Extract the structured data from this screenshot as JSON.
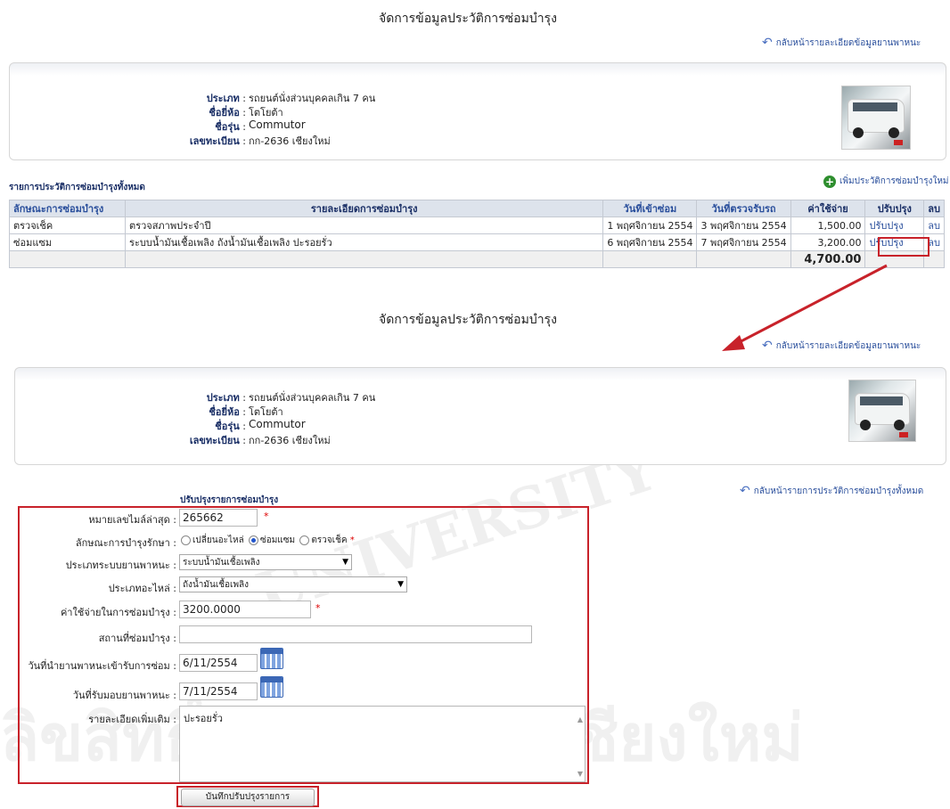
{
  "page_title": "จัดการข้อมูลประวัติการซ่อมบำรุง",
  "back_link_vehicle": "กลับหน้ารายละเอียดข้อมูลยานพาหนะ",
  "vehicle": {
    "type_label": "ประเภท",
    "type_value": "รถยนต์นั่งส่วนบุคคลเกิน 7 คน",
    "brand_label": "ชื่อยี่ห้อ",
    "brand_value": "โตโยต้า",
    "model_label": "ชื่อรุ่น",
    "model_value": "Commutor",
    "plate_label": "เลขทะเบียน",
    "plate_value": "กก-2636 เชียงใหม่"
  },
  "list_heading": "รายการประวัติการซ่อมบำรุงทั้งหมด",
  "add_link": "เพิ่มประวัติการซ่อมบำรุงใหม่",
  "table": {
    "headers": [
      "ลักษณะการซ่อมบำรุง",
      "รายละเอียดการซ่อมบำรุง",
      "วันที่เข้าซ่อม",
      "วันที่ตรวจรับรถ",
      "ค่าใช้จ่าย",
      "ปรับปรุง",
      "ลบ"
    ],
    "rows": [
      {
        "type": "ตรวจเช็ค",
        "detail": "ตรวจสภาพประจำปี",
        "in_date": "1 พฤศจิกายน 2554",
        "out_date": "3 พฤศจิกายน 2554",
        "cost": "1,500.00",
        "edit": "ปรับปรุง",
        "del": "ลบ"
      },
      {
        "type": "ซ่อมแซม",
        "detail": "ระบบน้ำมันเชื้อเพลิง ถังน้ำมันเชื้อเพลิง ปะรอยรั่ว",
        "in_date": "6 พฤศจิกายน 2554",
        "out_date": "7 พฤศจิกายน 2554",
        "cost": "3,200.00",
        "edit": "ปรับปรุง",
        "del": "ลบ"
      }
    ],
    "total": "4,700.00"
  },
  "back_link_history": "กลับหน้ารายการประวัติการซ่อมบำรุงทั้งหมด",
  "form": {
    "heading": "ปรับปรุงรายการซ่อมบำรุง",
    "mileage_label": "หมายเลขไมล์ล่าสุด :",
    "mileage_value": "265662",
    "kind_label": "ลักษณะการบำรุงรักษา :",
    "kind_options": [
      "เปลี่ยนอะไหล่",
      "ซ่อมแซม",
      "ตรวจเช็ค"
    ],
    "kind_selected": "ซ่อมแซม",
    "system_label": "ประเภทระบบยานพาหนะ :",
    "system_value": "ระบบน้ำมันเชื้อเพลิง",
    "part_label": "ประเภทอะไหล่ :",
    "part_value": "ถังน้ำมันเชื้อเพลิง",
    "cost_label": "ค่าใช้จ่ายในการซ่อมบำรุง :",
    "cost_value": "3200.0000",
    "place_label": "สถานที่ซ่อมบำรุง :",
    "place_value": "",
    "send_date_label": "วันที่นำยานพาหนะเข้ารับการซ่อม :",
    "send_date_value": "6/11/2554",
    "return_date_label": "วันที่รับมอบยานพาหนะ :",
    "return_date_value": "7/11/2554",
    "notes_label": "รายละเอียดเพิ่มเติม :",
    "notes_value": "ปะรอยรั่ว",
    "submit_label": "บันทึกปรับปรุงรายการ",
    "required_mark": "*"
  },
  "colors": {
    "annotation_red": "#c8222a",
    "link_blue": "#2a4f9c",
    "header_bg": "#dde3ec"
  }
}
